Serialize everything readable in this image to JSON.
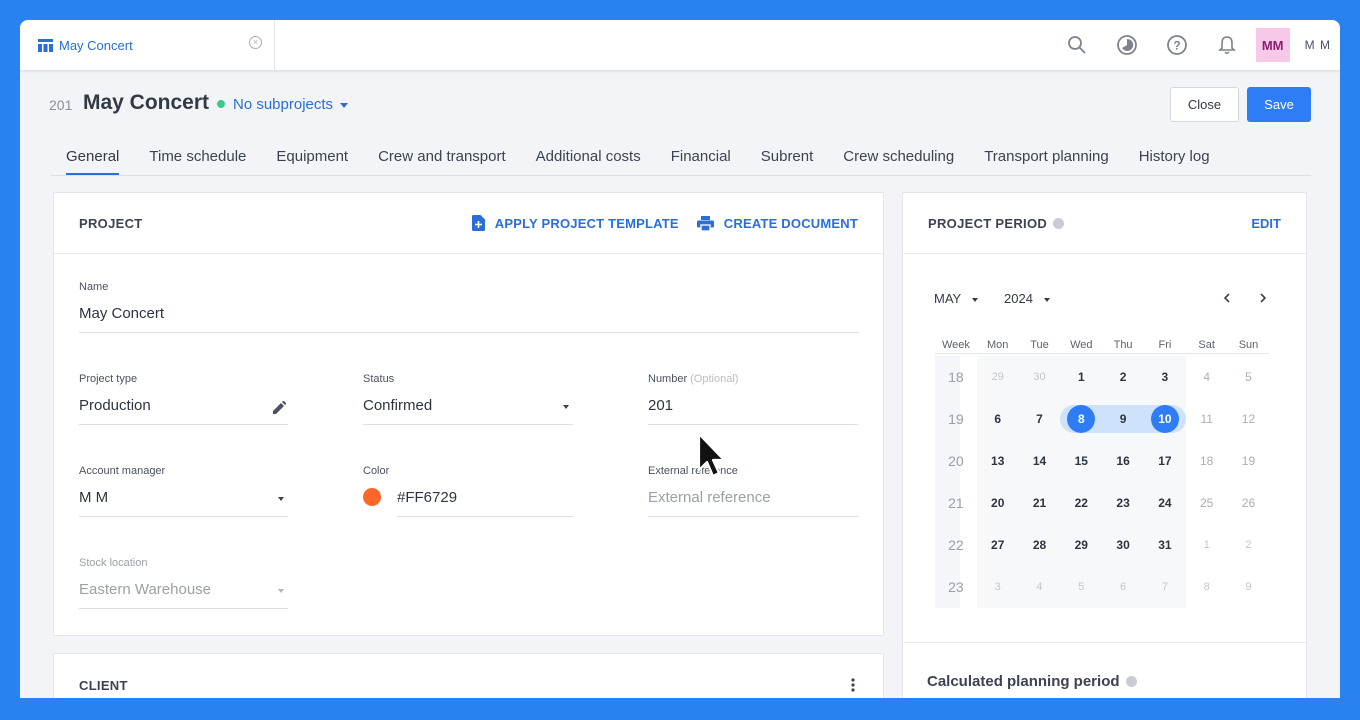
{
  "topbar": {
    "tab_label": "May Concert",
    "user_initials": "MM",
    "user_name": "M M"
  },
  "header": {
    "project_number": "201",
    "project_title": "May Concert",
    "subprojects": "No subprojects",
    "close_label": "Close",
    "save_label": "Save"
  },
  "tabs": [
    "General",
    "Time schedule",
    "Equipment",
    "Crew and transport",
    "Additional costs",
    "Financial",
    "Subrent",
    "Crew scheduling",
    "Transport planning",
    "History log"
  ],
  "project": {
    "title": "PROJECT",
    "apply_template": "APPLY PROJECT TEMPLATE",
    "create_document": "CREATE DOCUMENT",
    "name_label": "Name",
    "name_value": "May Concert",
    "type_label": "Project type",
    "type_value": "Production",
    "status_label": "Status",
    "status_value": "Confirmed",
    "number_label": "Number",
    "number_optional": "(Optional)",
    "number_value": "201",
    "manager_label": "Account manager",
    "manager_value": "M M",
    "color_label": "Color",
    "color_value": "#FF6729",
    "extref_label": "External reference",
    "extref_placeholder": "External reference",
    "stock_label": "Stock location",
    "stock_value": "Eastern Warehouse"
  },
  "client": {
    "title": "CLIENT"
  },
  "period": {
    "title": "PROJECT PERIOD",
    "edit": "EDIT",
    "month": "MAY",
    "year": "2024",
    "weekday_headers": [
      "Week",
      "Mon",
      "Tue",
      "Wed",
      "Thu",
      "Fri",
      "Sat",
      "Sun"
    ],
    "rows": [
      [
        "18",
        "29",
        "30",
        "1",
        "2",
        "3",
        "4",
        "5"
      ],
      [
        "19",
        "6",
        "7",
        "8",
        "9",
        "10",
        "11",
        "12"
      ],
      [
        "20",
        "13",
        "14",
        "15",
        "16",
        "17",
        "18",
        "19"
      ],
      [
        "21",
        "20",
        "21",
        "22",
        "23",
        "24",
        "25",
        "26"
      ],
      [
        "22",
        "27",
        "28",
        "29",
        "30",
        "31",
        "1",
        "2"
      ],
      [
        "23",
        "3",
        "4",
        "5",
        "6",
        "7",
        "8",
        "9"
      ]
    ],
    "calculated_title": "Calculated planning period"
  },
  "colors": {
    "accent": "#2f7df6",
    "project_color": "#FF6729",
    "status_dot": "#3cc98a"
  }
}
